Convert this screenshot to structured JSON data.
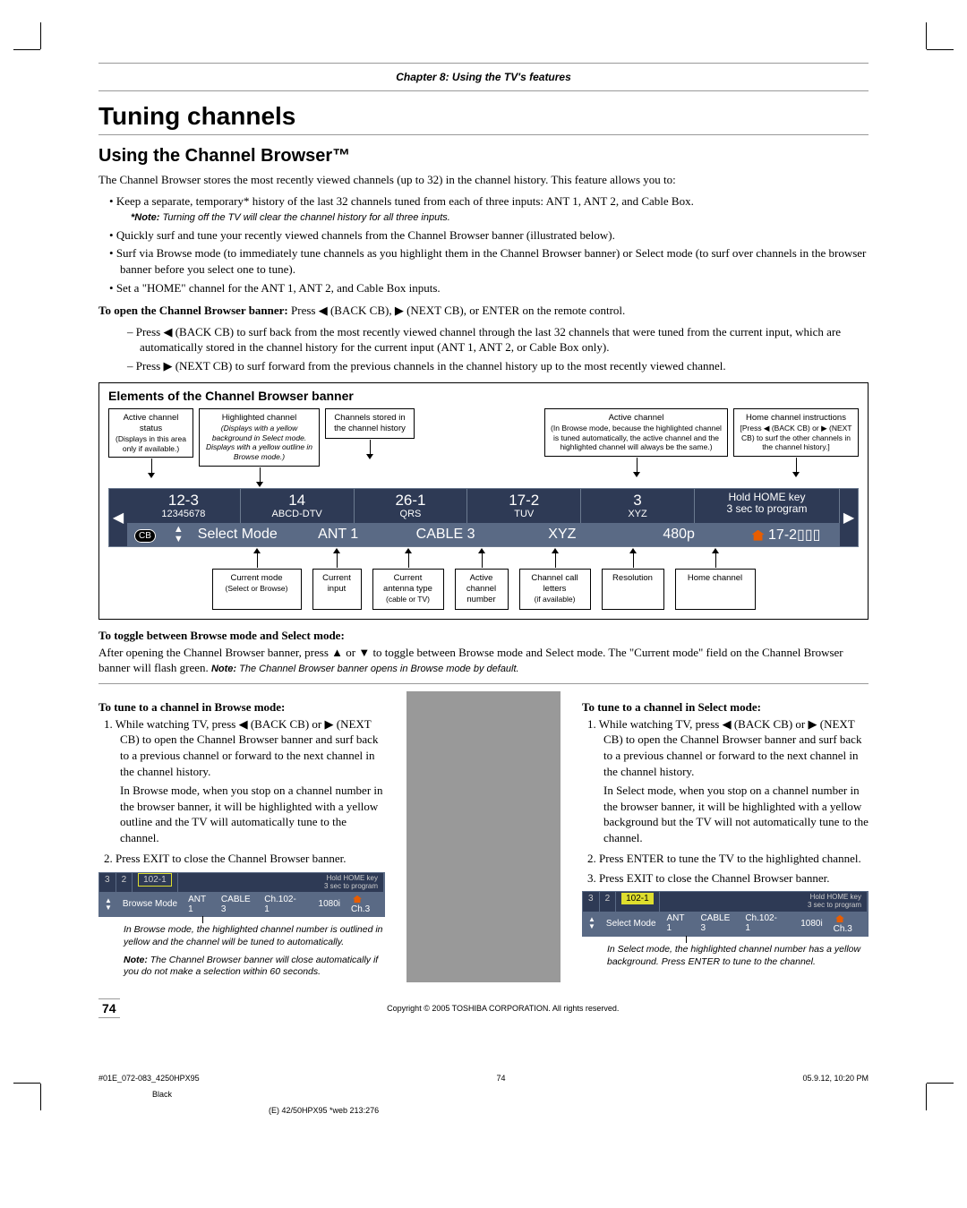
{
  "chapter": "Chapter 8: Using the TV's features",
  "h1": "Tuning channels",
  "h2": "Using the Channel Browser™",
  "intro": "The Channel Browser stores the most recently viewed channels (up to 32) in the channel history. This feature allows you to:",
  "bullets": {
    "b1": "Keep a separate, temporary* history of the last 32 channels tuned from each of three inputs: ANT 1, ANT 2, and Cable Box.",
    "b1note_label": "*Note:",
    "b1note": " Turning off the TV will clear the channel history for all three inputs.",
    "b2": "Quickly surf and tune your recently viewed channels from the Channel Browser banner (illustrated below).",
    "b3": "Surf via Browse mode (to immediately tune channels as you highlight them in the Channel Browser banner) or Select mode (to surf over channels in the browser banner before you select one to tune).",
    "b4": "Set a \"HOME\" channel for the ANT 1, ANT 2, and Cable Box inputs."
  },
  "open_banner_lead": "To open the Channel Browser banner:",
  "open_banner_rest": " Press ◀ (BACK CB), ▶ (NEXT CB), or ENTER on the remote control.",
  "sub1": "– Press ◀ (BACK CB) to surf back from the most recently viewed channel through the last 32 channels that were tuned from the current input, which are automatically stored in the channel history for the current input (ANT 1, ANT 2, or Cable Box only).",
  "sub2": "– Press ▶ (NEXT CB) to surf forward from the previous channels in the channel history up to the most recently viewed channel.",
  "diagram": {
    "title": "Elements of the Channel Browser banner",
    "top": {
      "c1t": "Active channel status",
      "c1s": "(Displays in this area only if available.)",
      "c2t": "Highlighted channel",
      "c2s": "(Displays with a yellow background in Select mode. Displays with a yellow outline in Browse mode.)",
      "c3t": "Channels stored in the channel history",
      "c4t": "Active channel",
      "c4s": "(In Browse mode, because the highlighted channel is tuned automatically, the active channel and the highlighted channel will always be the same.)",
      "c5t": "Home channel instructions",
      "c5s": "[Press ◀ (BACK CB) or ▶ (NEXT CB) to surf the other channels in the channel history.]"
    },
    "row1": {
      "c1a": "12-3",
      "c1b": "12345678",
      "c2a": "14",
      "c2b": "ABCD-DTV",
      "c3a": "26-1",
      "c3b": "QRS",
      "c4a": "17-2",
      "c4b": "TUV",
      "c5a": "3",
      "c5b": "XYZ",
      "c6a": "Hold HOME key",
      "c6b": "3 sec to program"
    },
    "row2": {
      "cb": "CB",
      "mode": "Select Mode",
      "input": "ANT 1",
      "antenna": "CABLE 3",
      "active": "XYZ",
      "res": "480p",
      "home": "17-2"
    },
    "bottom": {
      "c1t": "Current mode",
      "c1s": "(Select or Browse)",
      "c2": "Current input",
      "c3t": "Current antenna type",
      "c3s": "(cable or TV)",
      "c4t": "Active channel number",
      "c5t": "Channel call letters",
      "c5s": "(if available)",
      "c6": "Resolution",
      "c7": "Home channel"
    }
  },
  "toggle_head": "To toggle between Browse mode and Select mode:",
  "toggle_body_a": "After opening the Channel Browser banner, press ▲ or ▼ to toggle between Browse mode and Select mode.  The \"Current mode\" field on the Channel Browser banner will flash green.  ",
  "toggle_note_label": "Note:",
  "toggle_note": " The Channel Browser banner opens in Browse mode by default.",
  "browse": {
    "head": "To tune to a channel in Browse mode:",
    "s1": "1.  While watching TV, press ◀ (BACK CB) or ▶ (NEXT CB)  to open the Channel Browser banner and surf back to a previous channel or forward to the next channel in the channel history.",
    "s1b": "In Browse mode, when you stop on a channel number in the browser banner, it will be highlighted with a yellow outline and the TV will automatically tune to the channel.",
    "s2": "2.  Press EXIT to close the Channel Browser banner.",
    "cap1": "In Browse mode, the highlighted channel number is outlined in yellow and the channel will be tuned to automatically.",
    "cap2_label": "Note:",
    "cap2": " The Channel Browser banner will close automatically if you do not make a selection within 60 seconds."
  },
  "select": {
    "head": "To tune to a channel in Select mode:",
    "s1": "1.  While watching TV, press ◀ (BACK CB) or ▶ (NEXT CB)  to open the Channel Browser banner and surf back to a previous channel or forward to the next channel in the channel history.",
    "s1b": "In Select mode, when you stop on a channel number in the browser banner, it will be highlighted with a yellow background but the TV will not automatically tune to the channel.",
    "s2": "2.  Press ENTER to tune the TV to the highlighted channel.",
    "s3": "3.  Press EXIT to close the Channel Browser banner.",
    "cap": "In Select mode, the highlighted channel number has a yellow background. Press ENTER to tune to the channel."
  },
  "mini": {
    "vals": {
      "a": "3",
      "b": "2",
      "hl": "102-1",
      "hk1": "Hold HOME key",
      "hk2": "3 sec to program"
    },
    "row2": {
      "mode_b": "Browse Mode",
      "mode_s": "Select Mode",
      "in": "ANT 1",
      "ant": "CABLE 3",
      "ch": "Ch.102-1",
      "res": "1080i",
      "home": "Ch.3"
    }
  },
  "page_num": "74",
  "copyright": "Copyright © 2005 TOSHIBA CORPORATION. All rights reserved.",
  "print": {
    "file": "#01E_072-083_4250HPX95",
    "pg": "74",
    "ts": "05.9.12, 10:20 PM",
    "color": "Black",
    "ref": "(E) 42/50HPX95 *web 213:276"
  }
}
